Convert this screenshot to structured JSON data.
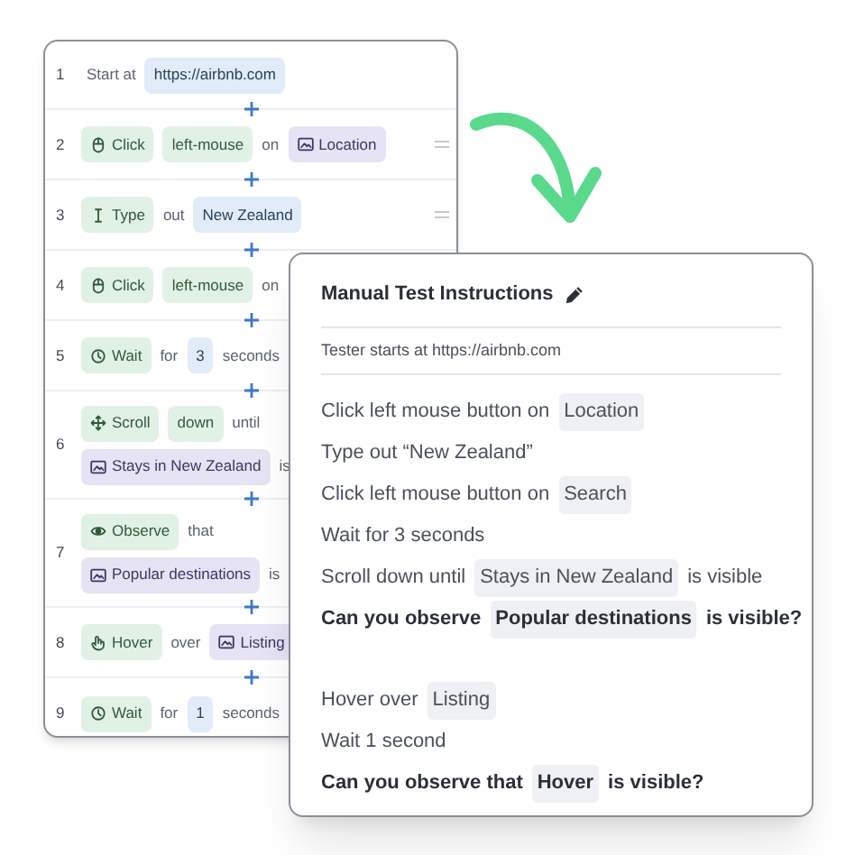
{
  "steps": [
    {
      "number": "1",
      "handle": false,
      "lines": [
        [
          {
            "kind": "text",
            "text": "Start at"
          },
          {
            "kind": "value",
            "text": "https://airbnb.com"
          }
        ]
      ]
    },
    {
      "number": "2",
      "handle": true,
      "lines": [
        [
          {
            "kind": "click",
            "text": "Click"
          },
          {
            "kind": "option",
            "text": "left-mouse"
          },
          {
            "kind": "text",
            "text": "on"
          },
          {
            "kind": "element",
            "text": "Location"
          }
        ]
      ]
    },
    {
      "number": "3",
      "handle": true,
      "lines": [
        [
          {
            "kind": "type",
            "text": "Type"
          },
          {
            "kind": "text",
            "text": "out"
          },
          {
            "kind": "value",
            "text": "New Zealand"
          }
        ]
      ]
    },
    {
      "number": "4",
      "handle": false,
      "lines": [
        [
          {
            "kind": "click",
            "text": "Click"
          },
          {
            "kind": "option",
            "text": "left-mouse"
          },
          {
            "kind": "text",
            "text": "on"
          }
        ]
      ]
    },
    {
      "number": "5",
      "handle": false,
      "lines": [
        [
          {
            "kind": "wait",
            "text": "Wait"
          },
          {
            "kind": "text",
            "text": "for"
          },
          {
            "kind": "value",
            "text": "3"
          },
          {
            "kind": "text",
            "text": "seconds"
          }
        ]
      ]
    },
    {
      "number": "6",
      "handle": false,
      "lines": [
        [
          {
            "kind": "scroll",
            "text": "Scroll"
          },
          {
            "kind": "option",
            "text": "down"
          },
          {
            "kind": "text",
            "text": "until"
          }
        ],
        [
          {
            "kind": "element",
            "text": "Stays in New Zealand"
          },
          {
            "kind": "text",
            "text": "is"
          }
        ]
      ]
    },
    {
      "number": "7",
      "handle": false,
      "lines": [
        [
          {
            "kind": "observe",
            "text": "Observe"
          },
          {
            "kind": "text",
            "text": "that"
          }
        ],
        [
          {
            "kind": "element",
            "text": "Popular destinations"
          },
          {
            "kind": "text",
            "text": "is"
          }
        ]
      ]
    },
    {
      "number": "8",
      "handle": false,
      "lines": [
        [
          {
            "kind": "hover",
            "text": "Hover"
          },
          {
            "kind": "text",
            "text": "over"
          },
          {
            "kind": "element",
            "text": "Listing"
          }
        ]
      ]
    },
    {
      "number": "9",
      "handle": false,
      "lines": [
        [
          {
            "kind": "wait",
            "text": "Wait"
          },
          {
            "kind": "text",
            "text": "for"
          },
          {
            "kind": "value",
            "text": "1"
          },
          {
            "kind": "text",
            "text": "seconds"
          }
        ]
      ]
    }
  ],
  "instructions": {
    "title": "Manual Test Instructions",
    "start": "Tester starts at https://airbnb.com",
    "lines": [
      {
        "kind": "line",
        "bold": false,
        "parts": [
          {
            "kind": "text",
            "text": "Click left mouse button on"
          },
          {
            "kind": "tag",
            "text": "Location"
          }
        ]
      },
      {
        "kind": "line",
        "bold": false,
        "parts": [
          {
            "kind": "text",
            "text": "Type out “New Zealand”"
          }
        ]
      },
      {
        "kind": "line",
        "bold": false,
        "parts": [
          {
            "kind": "text",
            "text": "Click left mouse button on"
          },
          {
            "kind": "tag",
            "text": "Search"
          }
        ]
      },
      {
        "kind": "line",
        "bold": false,
        "parts": [
          {
            "kind": "text",
            "text": "Wait for 3 seconds"
          }
        ]
      },
      {
        "kind": "line",
        "bold": false,
        "parts": [
          {
            "kind": "text",
            "text": "Scroll down until"
          },
          {
            "kind": "tag",
            "text": "Stays in New Zealand"
          },
          {
            "kind": "text",
            "text": "is visible"
          }
        ]
      },
      {
        "kind": "line",
        "bold": true,
        "parts": [
          {
            "kind": "text",
            "text": "Can you observe"
          },
          {
            "kind": "tag",
            "text": "Popular destinations"
          },
          {
            "kind": "text",
            "text": "is visible?"
          }
        ]
      },
      {
        "kind": "blank"
      },
      {
        "kind": "line",
        "bold": false,
        "parts": [
          {
            "kind": "text",
            "text": "Hover over"
          },
          {
            "kind": "tag",
            "text": "Listing"
          }
        ]
      },
      {
        "kind": "line",
        "bold": false,
        "parts": [
          {
            "kind": "text",
            "text": "Wait 1 second"
          }
        ]
      },
      {
        "kind": "line",
        "bold": true,
        "parts": [
          {
            "kind": "text",
            "text": "Can you observe that"
          },
          {
            "kind": "tag",
            "text": "Hover"
          },
          {
            "kind": "text",
            "text": "is visible?"
          }
        ]
      }
    ]
  }
}
